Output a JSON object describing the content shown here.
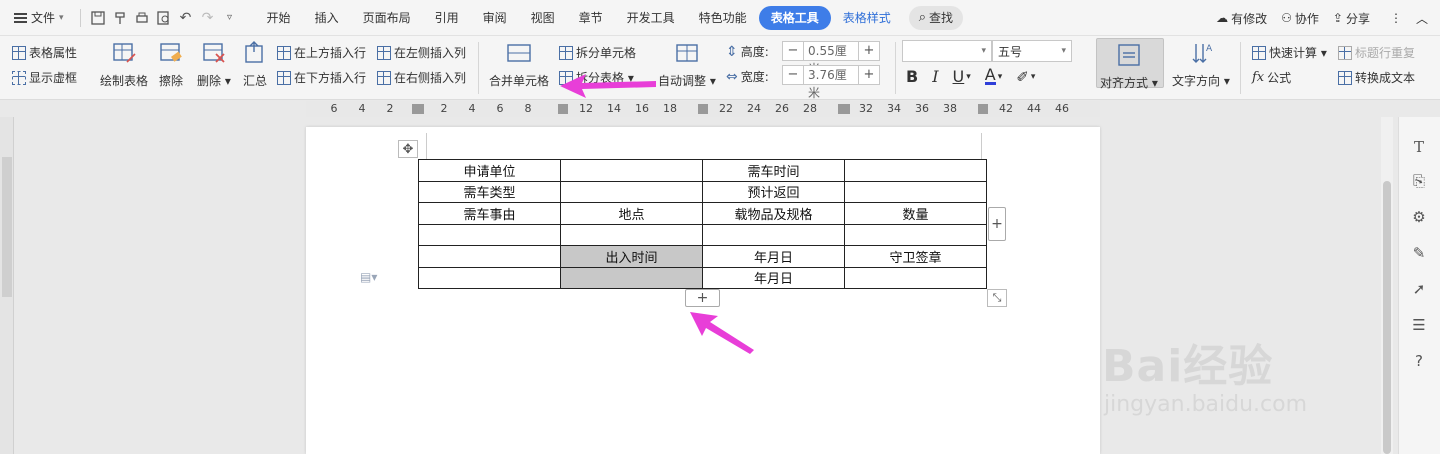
{
  "menubar": {
    "file_label": "文件",
    "tabs": [
      "开始",
      "插入",
      "页面布局",
      "引用",
      "审阅",
      "视图",
      "章节",
      "开发工具",
      "特色功能"
    ],
    "active_tab": "表格工具",
    "secondary_tab": "表格样式",
    "search_label": "查找",
    "right": {
      "changes": "有修改",
      "collab": "协作",
      "share": "分享"
    }
  },
  "ribbon": {
    "table_props": "表格属性",
    "show_grid": "显示虚框",
    "draw_table": "绘制表格",
    "erase": "擦除",
    "delete": "删除",
    "summary": "汇总",
    "insert_above": "在上方插入行",
    "insert_below": "在下方插入行",
    "insert_left": "在左侧插入列",
    "insert_right": "在右侧插入列",
    "merge_cells": "合并单元格",
    "split_cells": "拆分单元格",
    "split_table": "拆分表格",
    "auto_fit": "自动调整",
    "height_label": "高度:",
    "height_value": "0.55厘米",
    "width_label": "宽度:",
    "width_value": "3.76厘米",
    "font_size": "五号",
    "align": "对齐方式",
    "text_direction": "文字方向",
    "quick_calc": "快速计算",
    "repeat_header": "标题行重复",
    "formula": "公式",
    "to_text": "转换成文本"
  },
  "ruler": {
    "numbers": [
      "6",
      "4",
      "2",
      "2",
      "4",
      "6",
      "8",
      "12",
      "14",
      "16",
      "18",
      "22",
      "24",
      "26",
      "28",
      "32",
      "34",
      "36",
      "38",
      "42",
      "44",
      "46"
    ]
  },
  "table": {
    "rows": [
      [
        "申请单位",
        "",
        "需车时间",
        ""
      ],
      [
        "需车类型",
        "",
        "预计返回",
        ""
      ],
      [
        "需车事由",
        "地点",
        "载物品及规格",
        "数量"
      ],
      [
        "",
        "",
        "",
        ""
      ],
      [
        "",
        "出入时间",
        "年月日",
        "守卫签章"
      ],
      [
        "",
        "",
        "年月日",
        ""
      ]
    ]
  },
  "watermark": {
    "main": "Bai经验",
    "sub": "jingyan.baidu.com"
  },
  "colors": {
    "accent": "#3e7de8",
    "arrow": "#e83ed8",
    "selected_cell": "#c8c8c8"
  }
}
